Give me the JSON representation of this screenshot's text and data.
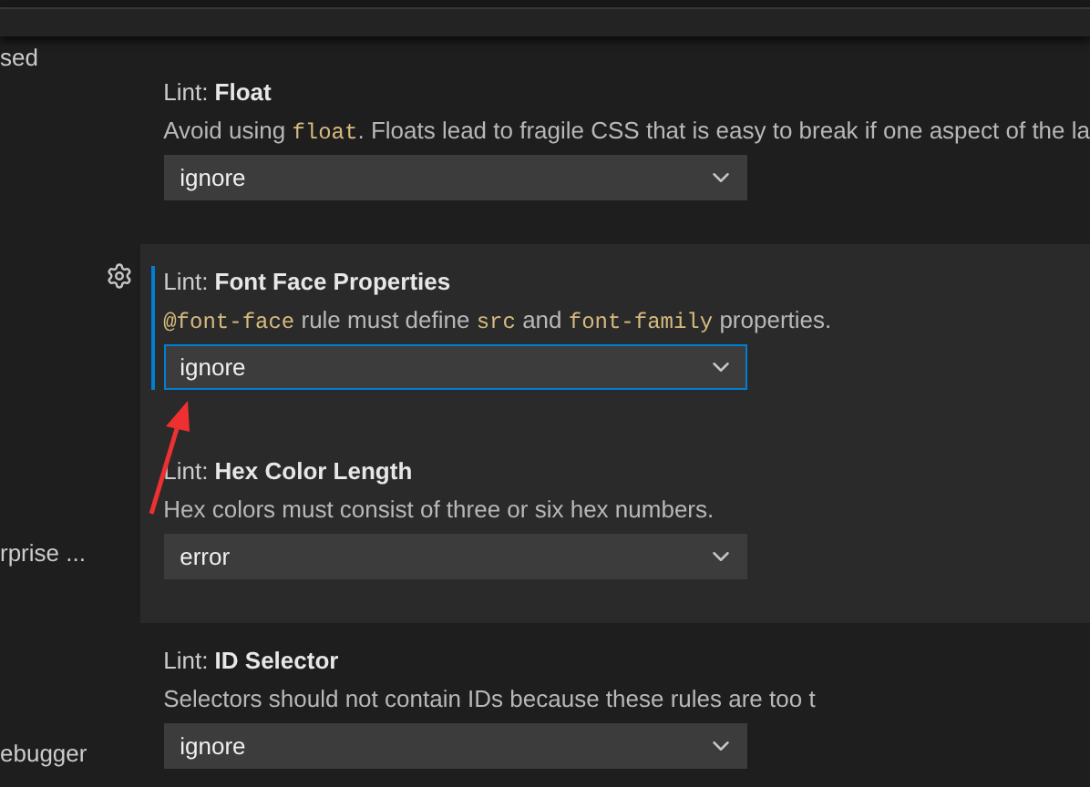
{
  "sidebar": {
    "items": [
      {
        "label": "sed"
      },
      {
        "label": "rprise ..."
      },
      {
        "label": "ebugger"
      }
    ]
  },
  "settings": [
    {
      "prefix": "Lint: ",
      "name": "Float",
      "description": [
        {
          "kind": "text",
          "text": "Avoid using "
        },
        {
          "kind": "code",
          "text": "float"
        },
        {
          "kind": "text",
          "text": ". Floats lead to fragile CSS that is easy to break if one aspect of the la"
        }
      ],
      "value": "ignore",
      "focused": false,
      "highlighted": false
    },
    {
      "prefix": "Lint: ",
      "name": "Font Face Properties",
      "description": [
        {
          "kind": "code",
          "text": "@font-face"
        },
        {
          "kind": "text",
          "text": " rule must define "
        },
        {
          "kind": "code",
          "text": "src"
        },
        {
          "kind": "text",
          "text": " and "
        },
        {
          "kind": "code",
          "text": "font-family"
        },
        {
          "kind": "text",
          "text": " properties."
        }
      ],
      "value": "ignore",
      "focused": true,
      "highlighted": true
    },
    {
      "prefix": "Lint: ",
      "name": "Hex Color Length",
      "description": [
        {
          "kind": "text",
          "text": "Hex colors must consist of three or six hex numbers."
        }
      ],
      "value": "error",
      "focused": false,
      "highlighted": true
    },
    {
      "prefix": "Lint: ",
      "name": "ID Selector",
      "description": [
        {
          "kind": "text",
          "text": "Selectors should not contain IDs because these rules are too t"
        }
      ],
      "value": "ignore",
      "focused": false,
      "highlighted": false
    }
  ]
}
